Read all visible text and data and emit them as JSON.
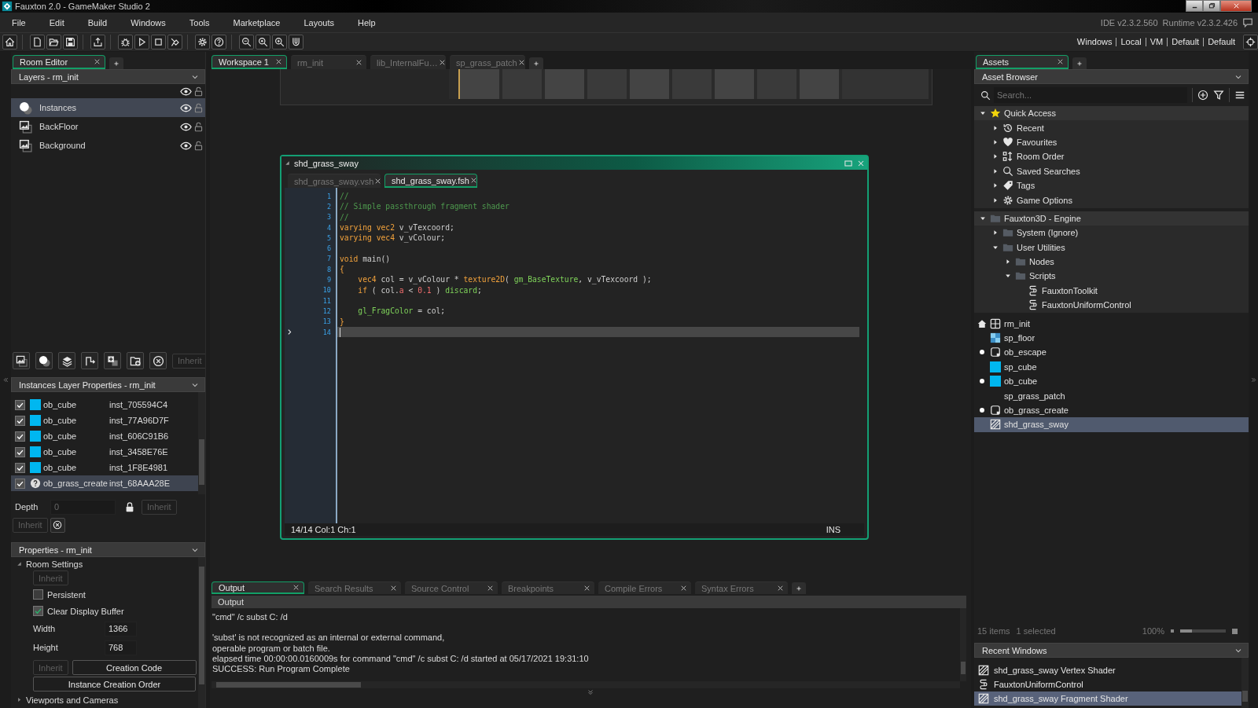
{
  "window": {
    "title": "Fauxton 2.0 - GameMaker Studio 2"
  },
  "menu": [
    "File",
    "Edit",
    "Build",
    "Windows",
    "Tools",
    "Marketplace",
    "Layouts",
    "Help"
  ],
  "versions": {
    "ide": "IDE v2.3.2.560",
    "runtime": "Runtime v2.3.2.426"
  },
  "targets": [
    "Windows",
    "Local",
    "VM",
    "Default",
    "Default"
  ],
  "left_panel": {
    "tabs": [
      {
        "label": "Room Editor",
        "selected": true
      }
    ],
    "layers": {
      "title": "Layers - rm_init",
      "items": [
        {
          "name": "Instances",
          "kind": "instance",
          "selected": true
        },
        {
          "name": "BackFloor",
          "kind": "background",
          "selected": false
        },
        {
          "name": "Background",
          "kind": "background",
          "selected": false
        }
      ]
    },
    "layer_tools": {
      "inherit": {
        "label": "Inherit",
        "disabled": true
      }
    },
    "instances": {
      "title": "Instances Layer Properties - rm_init",
      "rows": [
        {
          "checked": true,
          "kind": "sprite",
          "color": "#00b7f0",
          "object": "ob_cube",
          "id": "inst_705594C4",
          "selected": false
        },
        {
          "checked": true,
          "kind": "sprite",
          "color": "#00b7f0",
          "object": "ob_cube",
          "id": "inst_77A96D7F",
          "selected": false
        },
        {
          "checked": true,
          "kind": "sprite",
          "color": "#00b7f0",
          "object": "ob_cube",
          "id": "inst_606C91B6",
          "selected": false
        },
        {
          "checked": true,
          "kind": "sprite",
          "color": "#00b7f0",
          "object": "ob_cube",
          "id": "inst_3458E76E",
          "selected": false
        },
        {
          "checked": true,
          "kind": "sprite",
          "color": "#00b7f0",
          "object": "ob_cube",
          "id": "inst_1F8E4981",
          "selected": false
        },
        {
          "checked": true,
          "kind": "unknown",
          "object": "ob_grass_create",
          "id": "inst_68AAA28E",
          "selected": true
        }
      ]
    },
    "depth": {
      "label": "Depth",
      "value": "0",
      "disabled": true,
      "inherit": {
        "label": "Inherit",
        "disabled": true
      },
      "inherit_2": {
        "label": "Inherit",
        "disabled": true
      }
    },
    "properties": {
      "title": "Properties - rm_init",
      "section": {
        "label": "Room Settings",
        "expanded": true
      },
      "inherit": {
        "label": "Inherit",
        "disabled": true
      },
      "persistent": {
        "label": "Persistent",
        "checked": false
      },
      "clear_display": {
        "label": "Clear Display Buffer",
        "checked": true
      },
      "width": {
        "label": "Width",
        "value": "1366"
      },
      "height": {
        "label": "Height",
        "value": "768"
      },
      "inherit_2": {
        "label": "Inherit",
        "disabled": true
      },
      "creation_code": "Creation Code",
      "creation_order": "Instance Creation Order",
      "next_section": {
        "label": "Viewports and Cameras",
        "expanded": false
      }
    }
  },
  "workspace": {
    "tabs": [
      {
        "label": "Workspace 1",
        "selected": true
      },
      {
        "label": "rm_init",
        "selected": false
      },
      {
        "label": "lib_InternalFu…",
        "selected": false
      },
      {
        "label": "sp_grass_patch",
        "selected": false
      }
    ]
  },
  "shader_window": {
    "title": "shd_grass_sway",
    "tabs": [
      {
        "label": "shd_grass_sway.vsh",
        "selected": false
      },
      {
        "label": "shd_grass_sway.fsh",
        "selected": true
      }
    ],
    "lines": [
      {
        "number": "1",
        "current": false,
        "tokens": [
          {
            "text": "//",
            "kind": "comment"
          }
        ]
      },
      {
        "number": "2",
        "current": false,
        "tokens": [
          {
            "text": "// Simple passthrough fragment shader",
            "kind": "comment"
          }
        ]
      },
      {
        "number": "3",
        "current": false,
        "tokens": [
          {
            "text": "//",
            "kind": "comment"
          }
        ]
      },
      {
        "number": "4",
        "current": false,
        "tokens": [
          {
            "text": "varying vec2",
            "kind": "keyword"
          },
          {
            "text": " v_vTexcoord;",
            "kind": "plain"
          }
        ]
      },
      {
        "number": "5",
        "current": false,
        "tokens": [
          {
            "text": "varying vec4",
            "kind": "keyword"
          },
          {
            "text": " v_vColour;",
            "kind": "plain"
          }
        ]
      },
      {
        "number": "6",
        "current": false
      },
      {
        "number": "7",
        "current": false,
        "tokens": [
          {
            "text": "void",
            "kind": "keyword"
          },
          {
            "text": " main()",
            "kind": "plain"
          }
        ]
      },
      {
        "number": "8",
        "current": false,
        "tokens": [
          {
            "text": "{",
            "kind": "keyword"
          }
        ]
      },
      {
        "number": "9",
        "current": false,
        "tokens": [
          {
            "text": "    vec4",
            "kind": "keyword"
          },
          {
            "text": " col = v_vColour * ",
            "kind": "plain"
          },
          {
            "text": "texture2D",
            "kind": "keyword"
          },
          {
            "text": "( ",
            "kind": "plain"
          },
          {
            "text": "gm_BaseTexture",
            "kind": "builtin"
          },
          {
            "text": ", v_vTexcoord );",
            "kind": "plain"
          }
        ]
      },
      {
        "number": "10",
        "current": false,
        "tokens": [
          {
            "text": "    if",
            "kind": "keyword"
          },
          {
            "text": " ( col.",
            "kind": "plain"
          },
          {
            "text": "a",
            "kind": "number"
          },
          {
            "text": " < ",
            "kind": "plain"
          },
          {
            "text": "0.1",
            "kind": "number"
          },
          {
            "text": " ) ",
            "kind": "plain"
          },
          {
            "text": "discard",
            "kind": "builtin"
          },
          {
            "text": ";",
            "kind": "plain"
          }
        ]
      },
      {
        "number": "11",
        "current": false
      },
      {
        "number": "12",
        "current": false,
        "tokens": [
          {
            "text": "    gl_FragColor",
            "kind": "builtin"
          },
          {
            "text": " = col;",
            "kind": "plain"
          }
        ]
      },
      {
        "number": "13",
        "current": false,
        "tokens": [
          {
            "text": "}",
            "kind": "keyword"
          }
        ]
      },
      {
        "number": "14",
        "current": true
      }
    ],
    "status": "14/14 Col:1 Ch:1",
    "mode": "INS"
  },
  "output": {
    "tabs": [
      {
        "label": "Output",
        "selected": true
      },
      {
        "label": "Search Results",
        "selected": false
      },
      {
        "label": "Source Control",
        "selected": false
      },
      {
        "label": "Breakpoints",
        "selected": false
      },
      {
        "label": "Compile Errors",
        "selected": false
      },
      {
        "label": "Syntax Errors",
        "selected": false
      }
    ],
    "title": "Output",
    "blocks": [
      [
        "\"cmd\"  /c subst C: /d"
      ],
      [
        "'subst' is not recognized as an internal or external command,",
        "operable program or batch file.",
        "elapsed time 00:00:00.0160009s for command \"cmd\" /c subst C: /d started at 05/17/2021 19:31:10",
        "SUCCESS: Run Program Complete"
      ]
    ]
  },
  "right_panel": {
    "tabs": [
      {
        "label": "Assets",
        "selected": true
      }
    ],
    "title": "Asset Browser",
    "search": {
      "placeholder": "Search..."
    },
    "groups": [
      {
        "label": "Quick Access",
        "kind": "star",
        "expanded": true,
        "children": [
          {
            "label": "Recent",
            "kind": "history",
            "expanded": false
          },
          {
            "label": "Favourites",
            "kind": "heart",
            "expanded": false
          },
          {
            "label": "Room Order",
            "kind": "roomorder",
            "expanded": false
          },
          {
            "label": "Saved Searches",
            "kind": "search",
            "expanded": false
          },
          {
            "label": "Tags",
            "kind": "tag",
            "expanded": false
          },
          {
            "label": "Game Options",
            "kind": "gear",
            "expanded": false
          }
        ]
      },
      {
        "label": "Fauxton3D - Engine",
        "kind": "folder",
        "expanded": true,
        "children": [
          {
            "label": "System (Ignore)",
            "kind": "folder",
            "expanded": false
          },
          {
            "label": "User Utilities",
            "kind": "folder",
            "expanded": true,
            "children": [
              {
                "label": "Nodes",
                "kind": "folder",
                "expanded": false
              },
              {
                "label": "Scripts",
                "kind": "folder",
                "expanded": true,
                "children": [
                  {
                    "label": "FauxtonToolkit",
                    "kind": "script"
                  },
                  {
                    "label": "FauxtonUniformControl",
                    "kind": "script"
                  }
                ]
              }
            ]
          }
        ]
      }
    ],
    "assets": [
      {
        "label": "rm_init",
        "kind": "room",
        "home": true,
        "marked": false,
        "selected": false
      },
      {
        "label": "sp_floor",
        "kind": "tiles",
        "home": false,
        "marked": false,
        "selected": false
      },
      {
        "label": "ob_escape",
        "kind": "object",
        "home": false,
        "marked": true,
        "selected": false
      },
      {
        "label": "sp_cube",
        "kind": "sprite",
        "color": "#00b7f0",
        "home": false,
        "marked": false,
        "selected": false
      },
      {
        "label": "ob_cube",
        "kind": "sprite",
        "color": "#00b7f0",
        "home": false,
        "marked": true,
        "selected": false
      },
      {
        "label": "sp_grass_patch",
        "kind": "blank",
        "home": false,
        "marked": false,
        "selected": false
      },
      {
        "label": "ob_grass_create",
        "kind": "object",
        "home": false,
        "marked": true,
        "selected": false
      },
      {
        "label": "shd_grass_sway",
        "kind": "shader",
        "home": false,
        "marked": false,
        "selected": true
      }
    ],
    "footer": {
      "count": "15 items",
      "selection": "1 selected",
      "zoom": "100%",
      "level": 0.25
    },
    "recent": {
      "title": "Recent Windows",
      "items": [
        {
          "label": "shd_grass_sway Vertex Shader",
          "kind": "shader",
          "selected": false
        },
        {
          "label": "FauxtonUniformControl",
          "kind": "script",
          "selected": false
        },
        {
          "label": "shd_grass_sway Fragment Shader",
          "kind": "shader",
          "selected": true
        }
      ]
    }
  }
}
